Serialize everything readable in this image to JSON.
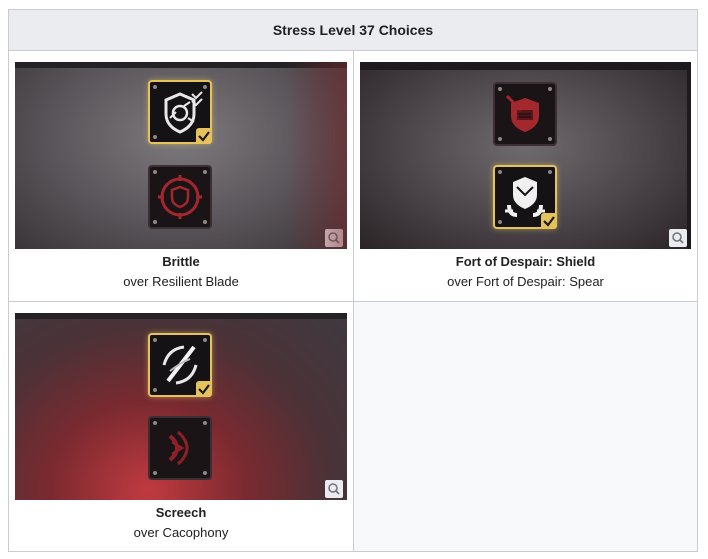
{
  "table": {
    "header": "Stress Level 37 Choices",
    "cells": [
      {
        "title": "Brittle",
        "subtitle": "over Resilient Blade",
        "selected_icon": "cracked-shield-icon",
        "other_icon": "target-shield-icon"
      },
      {
        "title": "Fort of Despair: Shield",
        "subtitle": "over Fort of Despair: Spear",
        "other_icon": "broken-fist-shield-icon",
        "selected_icon": "shield-fortress-icon"
      },
      {
        "title": "Screech",
        "subtitle": "over Cacophony",
        "selected_icon": "slash-swirl-icon",
        "other_icon": "sound-wave-icon"
      }
    ]
  },
  "colors": {
    "selected_border": "#e6c25a",
    "header_bg": "#eaecf0",
    "border": "#c8ccd1"
  }
}
